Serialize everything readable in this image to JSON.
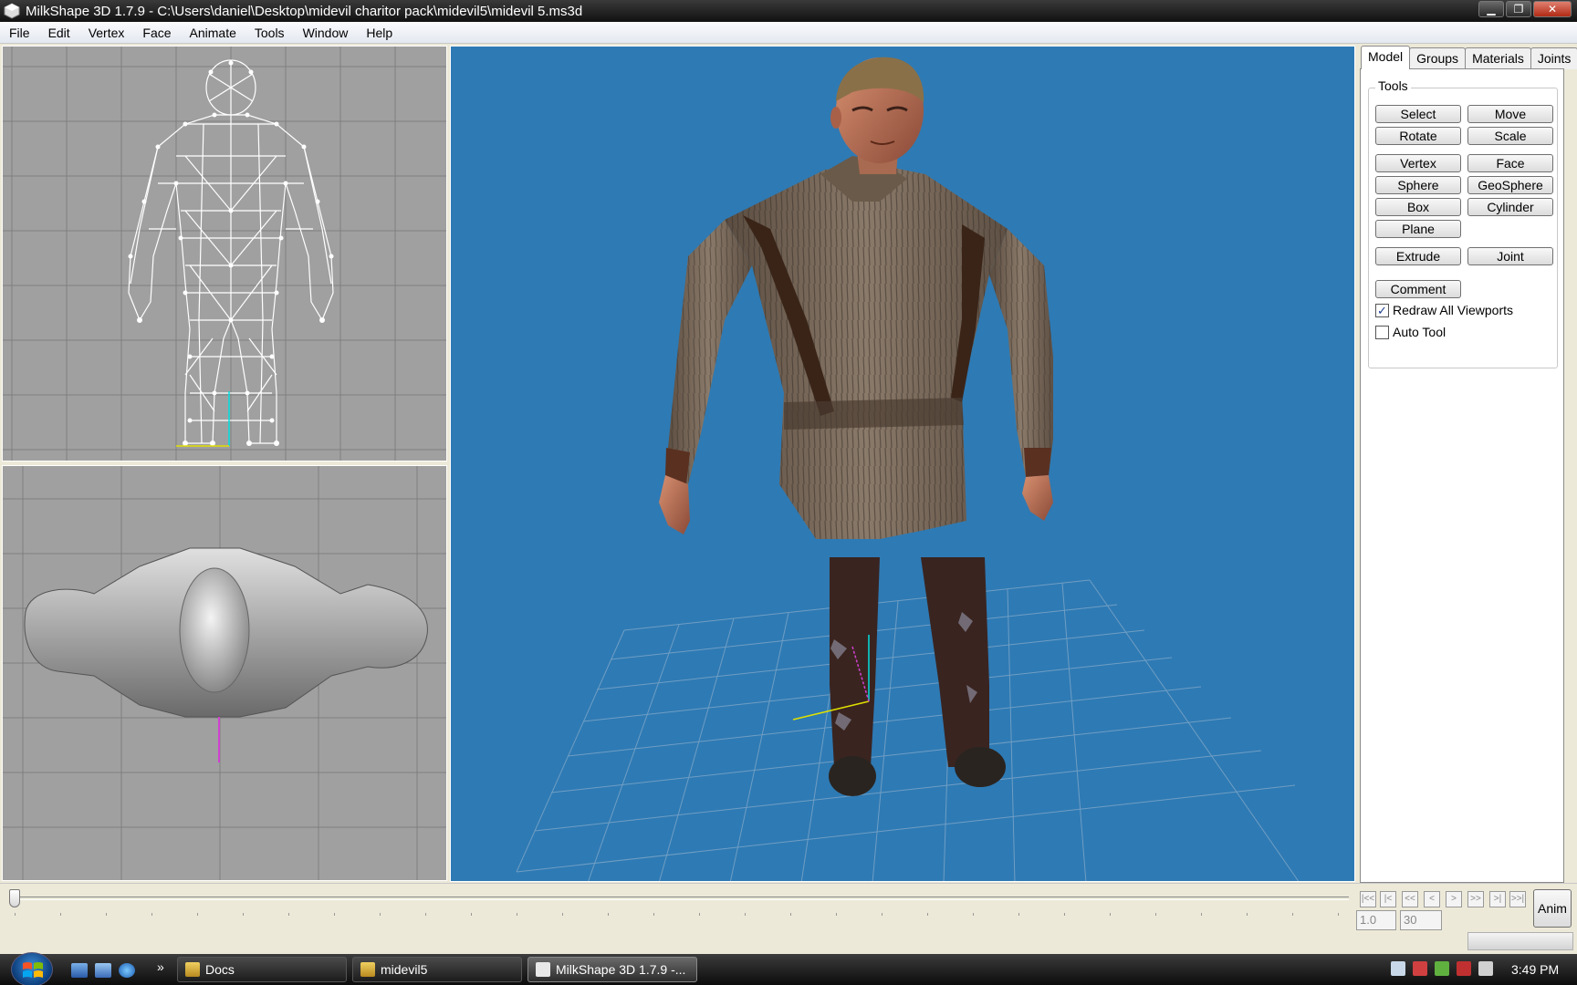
{
  "window": {
    "title": "MilkShape 3D 1.7.9 - C:\\Users\\daniel\\Desktop\\midevil charitor pack\\midevil5\\midevil 5.ms3d",
    "minimize": "▁",
    "maximize": "❐",
    "close": "✕"
  },
  "menu": [
    "File",
    "Edit",
    "Vertex",
    "Face",
    "Animate",
    "Tools",
    "Window",
    "Help"
  ],
  "panel": {
    "tabs": [
      "Model",
      "Groups",
      "Materials",
      "Joints"
    ],
    "active_tab": "Model",
    "tools_legend": "Tools",
    "buttons": {
      "select": "Select",
      "move": "Move",
      "rotate": "Rotate",
      "scale": "Scale",
      "vertex": "Vertex",
      "face": "Face",
      "sphere": "Sphere",
      "geosphere": "GeoSphere",
      "box": "Box",
      "cylinder": "Cylinder",
      "plane": "Plane",
      "extrude": "Extrude",
      "joint": "Joint",
      "comment": "Comment"
    },
    "checkboxes": {
      "redraw_all": {
        "label": "Redraw All Viewports",
        "checked": true,
        "mark": "✓"
      },
      "auto_tool": {
        "label": "Auto Tool",
        "checked": false,
        "mark": ""
      }
    }
  },
  "animation": {
    "nav": [
      "|<<",
      "|<",
      "<<",
      "<",
      ">",
      ">>",
      ">|",
      ">>|"
    ],
    "start_frame": "1.0",
    "end_frame": "30",
    "anim_button": "Anim",
    "timeline_position": 0
  },
  "taskbar": {
    "quicklaunch_more": "»",
    "tasks": [
      {
        "label": "Docs"
      },
      {
        "label": "midevil5"
      },
      {
        "label": "MilkShape 3D 1.7.9 -..."
      }
    ],
    "clock": "3:49 PM"
  },
  "colors": {
    "viewport_2d_bg": "#a0a0a0",
    "viewport_3d_bg": "#2e7ab4",
    "grid_3d": "#6f9ec4",
    "wireframe": "#ffffff"
  }
}
